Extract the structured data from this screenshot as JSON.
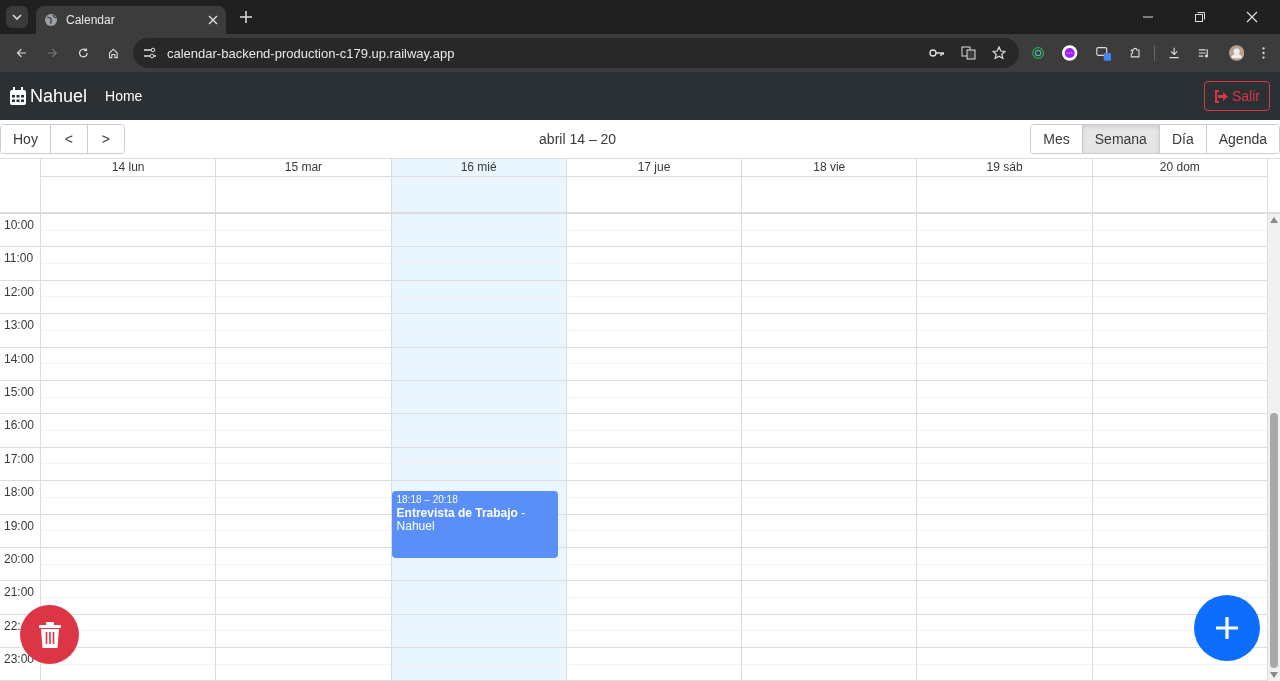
{
  "browser": {
    "tab_title": "Calendar",
    "url": "calendar-backend-production-c179.up.railway.app"
  },
  "navbar": {
    "brand": "Nahuel",
    "links": [
      "Home"
    ],
    "logout": "Salir"
  },
  "toolbar": {
    "nav_buttons": [
      "Hoy",
      "<",
      ">"
    ],
    "range_label": "abril 14 – 20",
    "views": [
      {
        "label": "Mes",
        "selected": false
      },
      {
        "label": "Semana",
        "selected": true
      },
      {
        "label": "Día",
        "selected": false
      },
      {
        "label": "Agenda",
        "selected": false
      }
    ]
  },
  "days": [
    {
      "label": "14 lun",
      "today": false
    },
    {
      "label": "15 mar",
      "today": false
    },
    {
      "label": "16 mié",
      "today": true,
      "events": [
        {
          "time": "18:18 – 20:18",
          "title": "**Entrevista de Trabajo** - Nahuel"
        }
      ]
    },
    {
      "label": "17 jue",
      "today": false
    },
    {
      "label": "18 vie",
      "today": false
    },
    {
      "label": "19 sáb",
      "today": false
    },
    {
      "label": "20 dom",
      "today": false
    }
  ],
  "hours": [
    "10:00",
    "11:00",
    "12:00",
    "13:00",
    "14:00",
    "15:00",
    "16:00",
    "17:00",
    "18:00",
    "19:00",
    "20:00",
    "21:00",
    "22:",
    "23:00"
  ]
}
